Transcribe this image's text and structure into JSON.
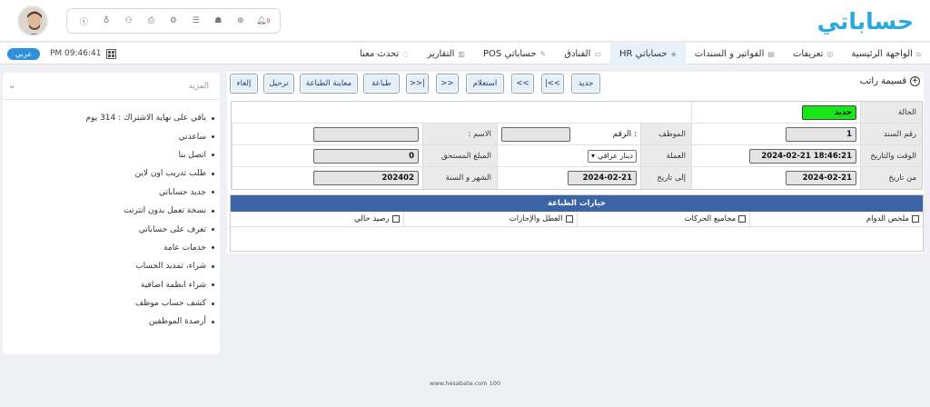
{
  "header": {
    "logo_text": "حساباتي",
    "brand_color": "#2aa8e0",
    "icons": [
      "dollar-icon",
      "bag-icon",
      "users-icon",
      "printer-icon",
      "gears-icon",
      "database-icon",
      "android-icon",
      "plus-circle-icon",
      "notification-bell-icon"
    ],
    "notification_count": "0"
  },
  "nav": {
    "lang_button": "عربي",
    "time": "PM 09:46:41",
    "tabs": [
      {
        "label": "الواجهة الرئيسية"
      },
      {
        "label": "تعريفات"
      },
      {
        "label": "الفواتير و السندات"
      },
      {
        "label": "حساباتي HR"
      },
      {
        "label": "الفنادق"
      },
      {
        "label": "حساباتي POS"
      },
      {
        "label": "التقارير"
      },
      {
        "label": "تحدث معنا"
      }
    ]
  },
  "sidebar": {
    "header": "المزيد",
    "items": [
      "باقي على نهاية الاشتراك : 314 يوم",
      "ساعدني",
      "اتصل بنا",
      "طلب تدريب اون لاين",
      "جديد حساباتي",
      "نسخة تعمل بدون انترنت",
      "تعرف على حساباتي",
      "خدمات عامة",
      "شراء، تمديد الحساب",
      "شراء انظمة اضافية",
      "كشف حساب موظف",
      "أرصدة الموظفين"
    ]
  },
  "toolbar": {
    "title": "قسيمة راتب",
    "new": "جديد",
    "first": "|<<",
    "prev": "<<",
    "query": "استعلام",
    "next": ">>",
    "last": ">>|",
    "print": "طباعة",
    "preview": "معاينة الطباعة",
    "post": "ترحيل",
    "cancel": "إلغاء"
  },
  "form": {
    "status_label": "الحالة",
    "status_value": "جديد",
    "doc_no_label": "رقم السند",
    "doc_no_value": "1",
    "employee_label": "الموظف",
    "number_label": "الرقم :",
    "number_value": "",
    "name_label": "الاسم :",
    "name_value": "",
    "datetime_label": "الوقت والتاريخ",
    "datetime_value": "2024-02-21 18:46:21",
    "currency_label": "العملة",
    "currency_value": "دينار عراقي",
    "amount_label": "المبلغ المستحق",
    "amount_value": "0",
    "from_label": "من تاريخ",
    "from_value": "2024-02-21",
    "to_label": "إلى تاريخ",
    "to_value": "2024-02-21",
    "month_label": "الشهر و السنة",
    "month_value": "202402"
  },
  "print_options": {
    "title": "خيارات الطباعة",
    "options": [
      "ملخص الدوام",
      "مجاميع الحركات",
      "العطل والإجازات",
      "رصيد حالي"
    ]
  },
  "footer": "www.hesabate.com 100"
}
